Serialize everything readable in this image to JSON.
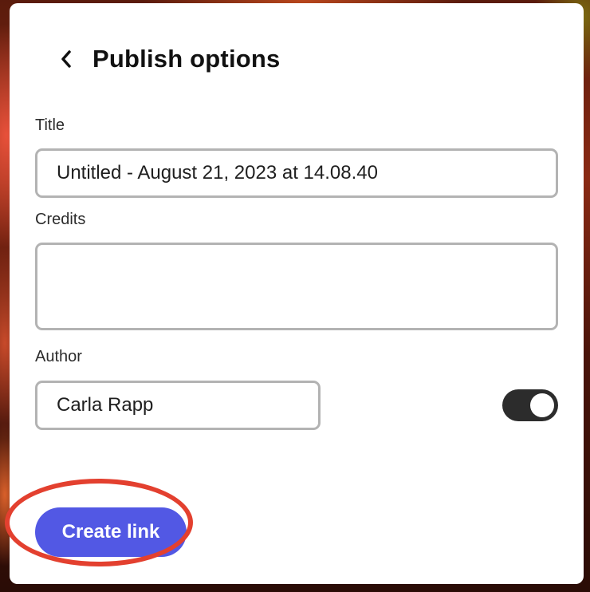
{
  "header": {
    "title": "Publish options",
    "back_icon": "chevron-left-icon"
  },
  "form": {
    "title_label": "Title",
    "title_value": "Untitled - August 21, 2023 at 14.08.40",
    "credits_label": "Credits",
    "credits_value": "",
    "author_label": "Author",
    "author_value": "Carla Rapp",
    "author_toggle_on": true
  },
  "actions": {
    "create_link_label": "Create link"
  },
  "colors": {
    "accent": "#5258e4",
    "toggle_on": "#2c2c2c",
    "annotation": "#e3402f"
  }
}
